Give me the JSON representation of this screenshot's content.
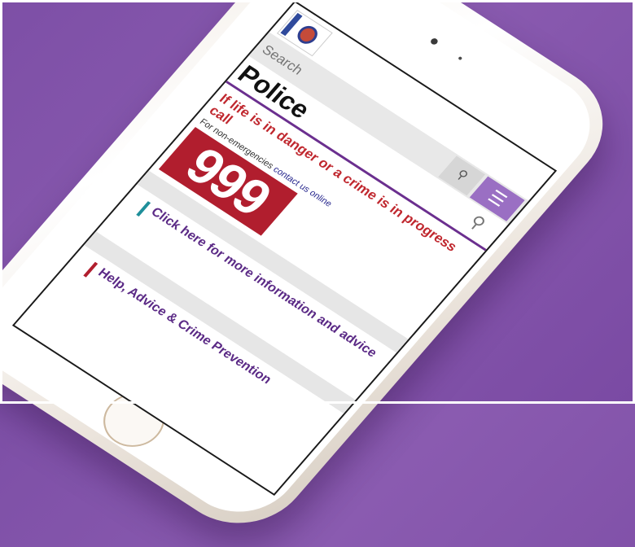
{
  "site": {
    "search_placeholder": "Search",
    "page_title": "Police",
    "danger_text": "If life is in danger or a crime is in progress call",
    "nonemergency_prefix": "For non-emergencies",
    "nonemergency_link": "contact us online",
    "emergency_number": "999",
    "cards": [
      {
        "label": "Click here for more information and advice",
        "accent": "#1f8f9a"
      },
      {
        "label": "Help, Advice & Crime Prevention",
        "accent": "#b11e2e"
      }
    ]
  },
  "colors": {
    "background": "#7d4fa6",
    "brand_purple": "#6b2f8f",
    "alert_red": "#c0282f",
    "number_bg": "#b11e2e"
  }
}
